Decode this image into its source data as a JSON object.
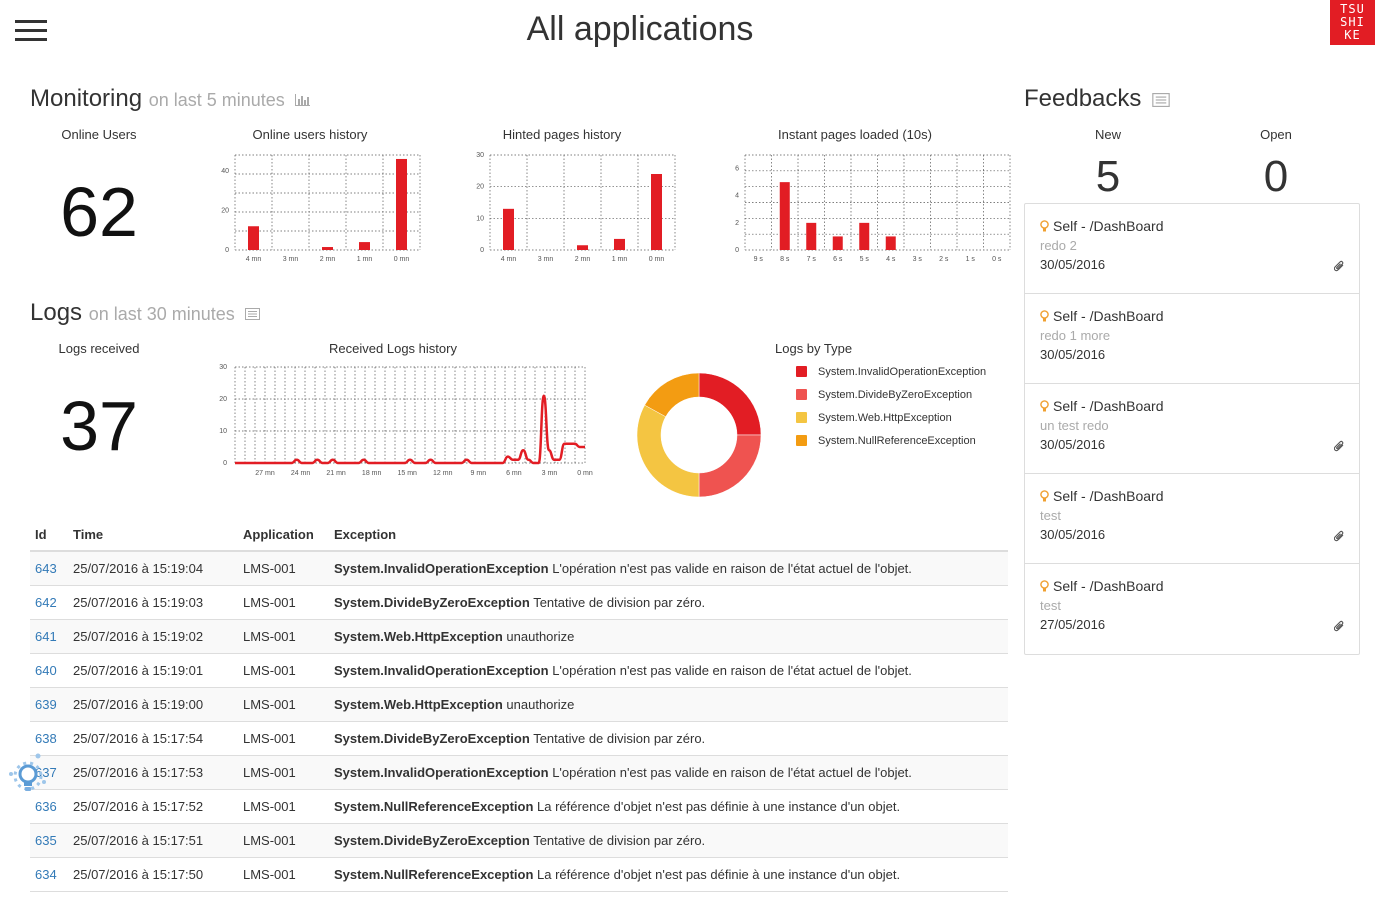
{
  "header": {
    "title": "All applications",
    "logo_text": [
      "TSU",
      "SHI",
      "KE"
    ]
  },
  "monitoring": {
    "title": "Monitoring",
    "subtitle": "on last 5 minutes",
    "online_users_label": "Online Users",
    "online_users_value": "62"
  },
  "logs_section": {
    "title": "Logs",
    "subtitle": "on last 30 minutes",
    "received_label": "Logs received",
    "received_value": "37"
  },
  "chart_data": [
    {
      "type": "bar",
      "title": "Online users history",
      "categories": [
        "4 mn",
        "3 mn",
        "2 mn",
        "1 mn",
        "0 mn"
      ],
      "values": [
        12,
        0,
        1.5,
        4,
        46
      ],
      "ylim": [
        0,
        48
      ],
      "yticks": [
        0,
        20,
        40
      ],
      "grid": true,
      "color": "#e21d24"
    },
    {
      "type": "bar",
      "title": "Hinted pages history",
      "categories": [
        "4 mn",
        "3 mn",
        "2 mn",
        "1 mn",
        "0 mn"
      ],
      "values": [
        13,
        0,
        1.5,
        3.5,
        24
      ],
      "ylim": [
        0,
        30
      ],
      "yticks": [
        0,
        10,
        20,
        30
      ],
      "grid": true,
      "color": "#e21d24"
    },
    {
      "type": "bar",
      "title": "Instant pages loaded (10s)",
      "categories": [
        "9 s",
        "8 s",
        "7 s",
        "6 s",
        "5 s",
        "4 s",
        "3 s",
        "2 s",
        "1 s",
        "0 s"
      ],
      "values": [
        0,
        5,
        2,
        1,
        2,
        1,
        0,
        0,
        0,
        0
      ],
      "ylim": [
        0,
        7
      ],
      "yticks": [
        0,
        2,
        4,
        6
      ],
      "grid": true,
      "color": "#e21d24"
    },
    {
      "type": "line",
      "title": "Received Logs history",
      "x_labels": [
        "27 mn",
        "24 mn",
        "21 mn",
        "18 mn",
        "15 mn",
        "12 mn",
        "9 mn",
        "6 mn",
        "3 mn",
        "0 mn"
      ],
      "values": [
        0,
        0,
        0,
        0,
        0,
        0,
        0,
        0,
        0,
        0,
        0,
        0,
        1,
        0,
        0,
        0,
        1,
        0,
        0,
        1,
        0,
        0,
        0,
        0,
        0,
        1,
        0,
        0,
        0,
        0,
        0,
        0,
        0,
        0,
        1,
        0,
        0,
        0,
        1,
        0,
        0,
        0,
        0,
        0,
        0,
        1,
        0,
        0,
        0,
        0,
        0,
        0,
        0,
        2,
        1,
        1,
        4,
        1,
        0,
        0,
        21,
        4,
        1,
        1,
        6,
        6,
        6,
        5,
        5
      ],
      "ylim": [
        0,
        30
      ],
      "yticks": [
        0,
        10,
        20,
        30
      ],
      "grid": true,
      "color": "#e21d24"
    },
    {
      "type": "pie",
      "title": "Logs by Type",
      "labels": [
        "System.InvalidOperationException",
        "System.DivideByZeroException",
        "System.Web.HttpException",
        "System.NullReferenceException"
      ],
      "values": [
        25,
        25,
        33,
        17
      ],
      "colors": [
        "#e21d24",
        "#ef5350",
        "#f4c542",
        "#f39c12"
      ],
      "donut": true
    }
  ],
  "logs_table": {
    "columns": [
      "Id",
      "Time",
      "Application",
      "Exception"
    ],
    "rows": [
      {
        "id": "643",
        "time": "25/07/2016 à 15:19:04",
        "app": "LMS-001",
        "type": "System.InvalidOperationException",
        "message": "L'opération n'est pas valide en raison de l'état actuel de l'objet."
      },
      {
        "id": "642",
        "time": "25/07/2016 à 15:19:03",
        "app": "LMS-001",
        "type": "System.DivideByZeroException",
        "message": "Tentative de division par zéro."
      },
      {
        "id": "641",
        "time": "25/07/2016 à 15:19:02",
        "app": "LMS-001",
        "type": "System.Web.HttpException",
        "message": "unauthorize"
      },
      {
        "id": "640",
        "time": "25/07/2016 à 15:19:01",
        "app": "LMS-001",
        "type": "System.InvalidOperationException",
        "message": "L'opération n'est pas valide en raison de l'état actuel de l'objet."
      },
      {
        "id": "639",
        "time": "25/07/2016 à 15:19:00",
        "app": "LMS-001",
        "type": "System.Web.HttpException",
        "message": "unauthorize"
      },
      {
        "id": "638",
        "time": "25/07/2016 à 15:17:54",
        "app": "LMS-001",
        "type": "System.DivideByZeroException",
        "message": "Tentative de division par zéro."
      },
      {
        "id": "637",
        "time": "25/07/2016 à 15:17:53",
        "app": "LMS-001",
        "type": "System.InvalidOperationException",
        "message": "L'opération n'est pas valide en raison de l'état actuel de l'objet."
      },
      {
        "id": "636",
        "time": "25/07/2016 à 15:17:52",
        "app": "LMS-001",
        "type": "System.NullReferenceException",
        "message": "La référence d'objet n'est pas définie à une instance d'un objet."
      },
      {
        "id": "635",
        "time": "25/07/2016 à 15:17:51",
        "app": "LMS-001",
        "type": "System.DivideByZeroException",
        "message": "Tentative de division par zéro."
      },
      {
        "id": "634",
        "time": "25/07/2016 à 15:17:50",
        "app": "LMS-001",
        "type": "System.NullReferenceException",
        "message": "La référence d'objet n'est pas définie à une instance d'un objet."
      }
    ]
  },
  "feedbacks": {
    "title": "Feedbacks",
    "new_label": "New",
    "new_value": "5",
    "open_label": "Open",
    "open_value": "0",
    "items": [
      {
        "title": "Self - /DashBoard",
        "subtitle": "redo 2",
        "date": "30/05/2016",
        "attachment": true
      },
      {
        "title": "Self - /DashBoard",
        "subtitle": "redo 1 more",
        "date": "30/05/2016",
        "attachment": false
      },
      {
        "title": "Self - /DashBoard",
        "subtitle": "un test redo",
        "date": "30/05/2016",
        "attachment": true
      },
      {
        "title": "Self - /DashBoard",
        "subtitle": "test",
        "date": "30/05/2016",
        "attachment": true
      },
      {
        "title": "Self - /DashBoard",
        "subtitle": "test",
        "date": "27/05/2016",
        "attachment": true
      }
    ]
  },
  "colors": {
    "accent": "#e21d24",
    "link": "#337ab7",
    "muted": "#aaaaaa",
    "bulb": "#f0a030"
  }
}
